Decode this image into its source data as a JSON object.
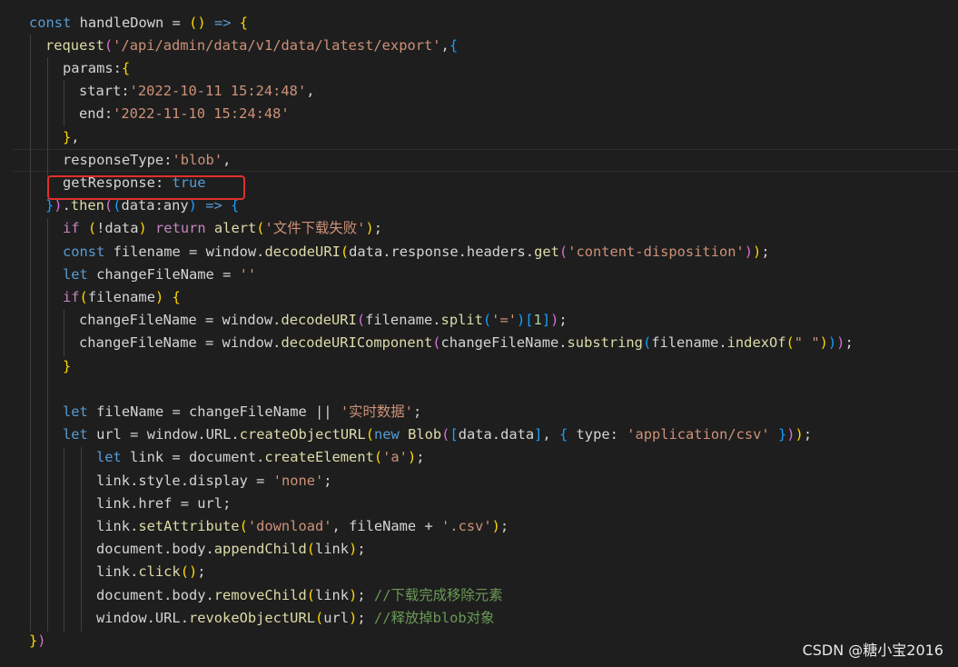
{
  "editor": {
    "theme_colors": {
      "background": "#1e1e1e",
      "keyword": "#569cd6",
      "control": "#c586c0",
      "function": "#dcdcaa",
      "string": "#ce9178",
      "comment": "#6a9955",
      "bracket_gold": "#ffd700",
      "bracket_purple": "#da70d6",
      "bracket_blue": "#179fff",
      "highlight_box": "#e0302a"
    },
    "lines": [
      [
        [
          "kw",
          "const"
        ],
        [
          "var",
          " handleDown "
        ],
        [
          "punc",
          "="
        ],
        [
          "var",
          " "
        ],
        [
          "b1",
          "()"
        ],
        [
          "var",
          " "
        ],
        [
          "kw",
          "=>"
        ],
        [
          "var",
          " "
        ],
        [
          "b1",
          "{"
        ]
      ],
      [
        [
          "fn",
          "request"
        ],
        [
          "b2",
          "("
        ],
        [
          "str",
          "'/api/admin/data/v1/data/latest/export'"
        ],
        [
          "punc",
          ","
        ],
        [
          "b3",
          "{"
        ]
      ],
      [
        [
          "prop",
          "params"
        ],
        [
          "punc",
          ":"
        ],
        [
          "b1",
          "{"
        ]
      ],
      [
        [
          "prop",
          "start"
        ],
        [
          "punc",
          ":"
        ],
        [
          "str",
          "'2022-10-11 15:24:48'"
        ],
        [
          "punc",
          ","
        ]
      ],
      [
        [
          "prop",
          "end"
        ],
        [
          "punc",
          ":"
        ],
        [
          "str",
          "'2022-11-10 15:24:48'"
        ]
      ],
      [
        [
          "b1",
          "}"
        ],
        [
          "punc",
          ","
        ]
      ],
      [
        [
          "prop",
          "responseType"
        ],
        [
          "punc",
          ":"
        ],
        [
          "str",
          "'blob'"
        ],
        [
          "punc",
          ","
        ]
      ],
      [
        [
          "prop",
          "getResponse"
        ],
        [
          "punc",
          ": "
        ],
        [
          "kw",
          "true"
        ]
      ],
      [
        [
          "b3",
          "}"
        ],
        [
          "b2",
          ")"
        ],
        [
          "punc",
          "."
        ],
        [
          "fn",
          "then"
        ],
        [
          "b2",
          "("
        ],
        [
          "b3",
          "("
        ],
        [
          "var",
          "data"
        ],
        [
          "punc",
          ":"
        ],
        [
          "var",
          "any"
        ],
        [
          "b3",
          ")"
        ],
        [
          "var",
          " "
        ],
        [
          "kw",
          "=>"
        ],
        [
          "var",
          " "
        ],
        [
          "b3",
          "{"
        ]
      ],
      [
        [
          "ctl",
          "if"
        ],
        [
          "var",
          " "
        ],
        [
          "b1",
          "("
        ],
        [
          "punc",
          "!"
        ],
        [
          "var",
          "data"
        ],
        [
          "b1",
          ")"
        ],
        [
          "var",
          " "
        ],
        [
          "ctl",
          "return"
        ],
        [
          "var",
          " "
        ],
        [
          "fn",
          "alert"
        ],
        [
          "b1",
          "("
        ],
        [
          "str",
          "'文件下载失败'"
        ],
        [
          "b1",
          ")"
        ],
        [
          "punc",
          ";"
        ]
      ],
      [
        [
          "kw",
          "const"
        ],
        [
          "var",
          " filename "
        ],
        [
          "punc",
          "="
        ],
        [
          "var",
          " window"
        ],
        [
          "punc",
          "."
        ],
        [
          "fn",
          "decodeURI"
        ],
        [
          "b1",
          "("
        ],
        [
          "var",
          "data"
        ],
        [
          "punc",
          "."
        ],
        [
          "var",
          "response"
        ],
        [
          "punc",
          "."
        ],
        [
          "var",
          "headers"
        ],
        [
          "punc",
          "."
        ],
        [
          "fn",
          "get"
        ],
        [
          "b2",
          "("
        ],
        [
          "str",
          "'content-disposition'"
        ],
        [
          "b2",
          ")"
        ],
        [
          "b1",
          ")"
        ],
        [
          "punc",
          ";"
        ]
      ],
      [
        [
          "kw",
          "let"
        ],
        [
          "var",
          " changeFileName "
        ],
        [
          "punc",
          "="
        ],
        [
          "var",
          " "
        ],
        [
          "str",
          "''"
        ]
      ],
      [
        [
          "ctl",
          "if"
        ],
        [
          "b1",
          "("
        ],
        [
          "var",
          "filename"
        ],
        [
          "b1",
          ")"
        ],
        [
          "var",
          " "
        ],
        [
          "b1",
          "{"
        ]
      ],
      [
        [
          "var",
          "changeFileName "
        ],
        [
          "punc",
          "="
        ],
        [
          "var",
          " window"
        ],
        [
          "punc",
          "."
        ],
        [
          "fn",
          "decodeURI"
        ],
        [
          "b2",
          "("
        ],
        [
          "var",
          "filename"
        ],
        [
          "punc",
          "."
        ],
        [
          "fn",
          "split"
        ],
        [
          "b3",
          "("
        ],
        [
          "str",
          "'='"
        ],
        [
          "b3",
          ")"
        ],
        [
          "b3",
          "["
        ],
        [
          "num",
          "1"
        ],
        [
          "b3",
          "]"
        ],
        [
          "b2",
          ")"
        ],
        [
          "punc",
          ";"
        ]
      ],
      [
        [
          "var",
          "changeFileName "
        ],
        [
          "punc",
          "="
        ],
        [
          "var",
          " window"
        ],
        [
          "punc",
          "."
        ],
        [
          "fn",
          "decodeURIComponent"
        ],
        [
          "b2",
          "("
        ],
        [
          "var",
          "changeFileName"
        ],
        [
          "punc",
          "."
        ],
        [
          "fn",
          "substring"
        ],
        [
          "b3",
          "("
        ],
        [
          "var",
          "filename"
        ],
        [
          "punc",
          "."
        ],
        [
          "fn",
          "indexOf"
        ],
        [
          "b1",
          "("
        ],
        [
          "str",
          "\" \""
        ],
        [
          "b1",
          ")"
        ],
        [
          "b3",
          ")"
        ],
        [
          "b2",
          ")"
        ],
        [
          "punc",
          ";"
        ]
      ],
      [
        [
          "b1",
          "}"
        ]
      ],
      [],
      [
        [
          "kw",
          "let"
        ],
        [
          "var",
          " fileName "
        ],
        [
          "punc",
          "="
        ],
        [
          "var",
          " changeFileName "
        ],
        [
          "punc",
          "||"
        ],
        [
          "var",
          " "
        ],
        [
          "str",
          "'实时数据'"
        ],
        [
          "punc",
          ";"
        ]
      ],
      [
        [
          "kw",
          "let"
        ],
        [
          "var",
          " url "
        ],
        [
          "punc",
          "="
        ],
        [
          "var",
          " window"
        ],
        [
          "punc",
          "."
        ],
        [
          "var",
          "URL"
        ],
        [
          "punc",
          "."
        ],
        [
          "fn",
          "createObjectURL"
        ],
        [
          "b1",
          "("
        ],
        [
          "kw",
          "new"
        ],
        [
          "var",
          " "
        ],
        [
          "fn",
          "Blob"
        ],
        [
          "b2",
          "("
        ],
        [
          "b3",
          "["
        ],
        [
          "var",
          "data"
        ],
        [
          "punc",
          "."
        ],
        [
          "var",
          "data"
        ],
        [
          "b3",
          "]"
        ],
        [
          "punc",
          ","
        ],
        [
          "var",
          " "
        ],
        [
          "b3",
          "{"
        ],
        [
          "var",
          " type"
        ],
        [
          "punc",
          ":"
        ],
        [
          "var",
          " "
        ],
        [
          "str",
          "'application/csv'"
        ],
        [
          "var",
          " "
        ],
        [
          "b3",
          "}"
        ],
        [
          "b2",
          ")"
        ],
        [
          "b1",
          ")"
        ],
        [
          "punc",
          ";"
        ]
      ],
      [
        [
          "kw",
          "let"
        ],
        [
          "var",
          " link "
        ],
        [
          "punc",
          "="
        ],
        [
          "var",
          " document"
        ],
        [
          "punc",
          "."
        ],
        [
          "fn",
          "createElement"
        ],
        [
          "b1",
          "("
        ],
        [
          "str",
          "'a'"
        ],
        [
          "b1",
          ")"
        ],
        [
          "punc",
          ";"
        ]
      ],
      [
        [
          "var",
          "link"
        ],
        [
          "punc",
          "."
        ],
        [
          "var",
          "style"
        ],
        [
          "punc",
          "."
        ],
        [
          "var",
          "display "
        ],
        [
          "punc",
          "="
        ],
        [
          "var",
          " "
        ],
        [
          "str",
          "'none'"
        ],
        [
          "punc",
          ";"
        ]
      ],
      [
        [
          "var",
          "link"
        ],
        [
          "punc",
          "."
        ],
        [
          "var",
          "href "
        ],
        [
          "punc",
          "="
        ],
        [
          "var",
          " url"
        ],
        [
          "punc",
          ";"
        ]
      ],
      [
        [
          "var",
          "link"
        ],
        [
          "punc",
          "."
        ],
        [
          "fn",
          "setAttribute"
        ],
        [
          "b1",
          "("
        ],
        [
          "str",
          "'download'"
        ],
        [
          "punc",
          ","
        ],
        [
          "var",
          " fileName "
        ],
        [
          "punc",
          "+"
        ],
        [
          "var",
          " "
        ],
        [
          "str",
          "'.csv'"
        ],
        [
          "b1",
          ")"
        ],
        [
          "punc",
          ";"
        ]
      ],
      [
        [
          "var",
          "document"
        ],
        [
          "punc",
          "."
        ],
        [
          "var",
          "body"
        ],
        [
          "punc",
          "."
        ],
        [
          "fn",
          "appendChild"
        ],
        [
          "b1",
          "("
        ],
        [
          "var",
          "link"
        ],
        [
          "b1",
          ")"
        ],
        [
          "punc",
          ";"
        ]
      ],
      [
        [
          "var",
          "link"
        ],
        [
          "punc",
          "."
        ],
        [
          "fn",
          "click"
        ],
        [
          "b1",
          "()"
        ],
        [
          "punc",
          ";"
        ]
      ],
      [
        [
          "var",
          "document"
        ],
        [
          "punc",
          "."
        ],
        [
          "var",
          "body"
        ],
        [
          "punc",
          "."
        ],
        [
          "fn",
          "removeChild"
        ],
        [
          "b1",
          "("
        ],
        [
          "var",
          "link"
        ],
        [
          "b1",
          ")"
        ],
        [
          "punc",
          ";"
        ],
        [
          "var",
          " "
        ],
        [
          "cmt",
          "//下载完成移除元素"
        ]
      ],
      [
        [
          "var",
          "window"
        ],
        [
          "punc",
          "."
        ],
        [
          "var",
          "URL"
        ],
        [
          "punc",
          "."
        ],
        [
          "fn",
          "revokeObjectURL"
        ],
        [
          "b1",
          "("
        ],
        [
          "var",
          "url"
        ],
        [
          "b1",
          ")"
        ],
        [
          "punc",
          ";"
        ],
        [
          "var",
          " "
        ],
        [
          "cmt",
          "//释放掉blob对象"
        ]
      ],
      [
        [
          "b1",
          "}"
        ],
        [
          "b2",
          ")"
        ]
      ]
    ]
  },
  "watermark": {
    "text": "CSDN @糖小宝2016"
  }
}
